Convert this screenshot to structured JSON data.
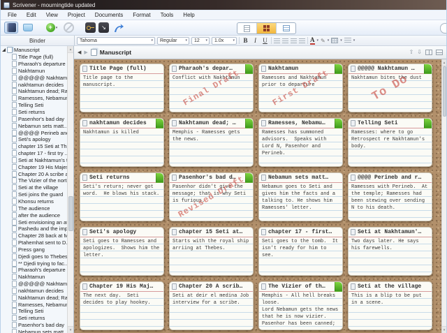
{
  "window": {
    "title": "Scrivener - mourningtide updated"
  },
  "menu": {
    "items": [
      "File",
      "Edit",
      "View",
      "Project",
      "Documents",
      "Format",
      "Tools",
      "Help"
    ]
  },
  "toolbar": {
    "buttons": [
      "binder",
      "collections",
      "add",
      "no-style",
      "keywords",
      "full-screen",
      "compose"
    ],
    "view_modes": [
      "document",
      "corkboard",
      "outliner"
    ],
    "active_view": "corkboard"
  },
  "format_bar": {
    "font": "Tahoma",
    "style": "Regular",
    "size": "12",
    "line_spacing": "1.0x",
    "bold": "B",
    "italic": "I",
    "underline": "U",
    "color_label": "A"
  },
  "icons": {
    "back": "◀",
    "forward": "▶",
    "nav_up": "⇧",
    "nav_down": "⇩",
    "caret": "▾",
    "plus": "+",
    "arrow_se": "↘",
    "scroll_up": "▴",
    "scroll_down": "▾",
    "pencil": "✎"
  },
  "binder": {
    "header": "Binder",
    "root": "Manuscript",
    "items": [
      "Title Page (full)",
      "Pharaoh's departure ...",
      "Nakhtamun",
      "@@@@@ Nakhtam...",
      "nakhtamun decides",
      "Nakhtamun dead; Ra...",
      "Ramesses, Nebamun...",
      "Telling Seti",
      "Seti returns",
      "Pasenhor's bad day",
      "Nebamun sets matt...",
      "@@@@ Perineb and ...",
      "Seti's apology",
      "chapter 15 Seti at Th...",
      "chapter 17 - first try ...",
      "Seti at Nakhtamun's t...",
      "Chapter 19 His Majes...",
      "Chapter 20 A scribe a...",
      "The Vizier of the north",
      "Seti at the village",
      "Seti joins the guard",
      "Khonsu returns",
      "The audience",
      "after the audience",
      "Seti envisioning an at...",
      "Pashedu and the imp...",
      "Chapter 28 back at M...",
      "Ptahemhat sent to D...",
      "Press gang",
      "Djedi goes to Thebes...",
      "** Djedi trying to fac...",
      "Pharaoh's departure ...",
      "Nakhtamun",
      "@@@@@ Nakhtam...",
      "nakhtamun decides",
      "Nakhtamun dead; Ra...",
      "Ramesses, Nebamun...",
      "Telling Seti",
      "Seti returns",
      "Pasenhor's bad day",
      "Nebamun sets matt..."
    ]
  },
  "editor_header": {
    "title": "Manuscript"
  },
  "corkboard": {
    "cards": [
      {
        "title": "Title Page (full)",
        "body": "Title page to the\nmanuscript.",
        "label": false,
        "stamp": null
      },
      {
        "title": "Pharaoh's depar…",
        "body": "Conflict with Nakhtamun",
        "label": true,
        "stamp": "Final Draft"
      },
      {
        "title": "Nakhtamun",
        "body": "Ramesses and Nakhtamun\nprior to departure",
        "label": true,
        "stamp": "First Draft"
      },
      {
        "title": "@@@@@ Nakhtamun …",
        "body": "Nakhtamun bites the dust",
        "label": true,
        "stamp": "To Do"
      },
      {
        "title": "nakhtamun decides",
        "body": "Nakhtamun is killed",
        "label": true,
        "stamp": null
      },
      {
        "title": "Nakhtamun dead; …",
        "body": "Memphis - Ramesses gets\nthe news.",
        "label": true,
        "stamp": null
      },
      {
        "title": "Ramesses, Nebamu…",
        "body": "Ramesses has summoned\nadvisors.  Speaks with\nLord N, Pasenhor and\nPerineb.",
        "label": true,
        "stamp": null
      },
      {
        "title": "Telling Seti",
        "body": "Ramesses: where to go\nRetrospect re Nakhtamun's\nbody.",
        "label": true,
        "stamp": null
      },
      {
        "title": "Seti returns",
        "body": "Seti's return; never got\nword.  He blows his stack.",
        "label": true,
        "stamp": null
      },
      {
        "title": "Pasenhor's bad d…",
        "body": "Pasenhor didn't give the\nmessage; that is why Seti\nis furious.",
        "label": true,
        "stamp": "Revised Draft"
      },
      {
        "title": "Nebamun sets matt…",
        "body": "Nebamun goes to Seti and\ngives him the facts and a\ntalking to. He shows him\nRamesses' letter.",
        "label": false,
        "stamp": null
      },
      {
        "title": "@@@@ Perineb and r…",
        "body": "Ramesses with Perineb.  At\nthe temple; Ramesses had\nbeen stewing over sending\nN to his death.",
        "label": false,
        "stamp": null
      },
      {
        "title": "Seti's apology",
        "body": "Seti goes to Ramesses and\napologizes.  Shows him the\nletter.",
        "label": false,
        "stamp": null
      },
      {
        "title": "chapter 15 Seti at…",
        "body": "Starts with the royal ship\narriing at Thebes.",
        "label": false,
        "stamp": null
      },
      {
        "title": "chapter 17 - first…",
        "body": "Seti goes to the tomb.  It\nisn't ready for him to\nsee.",
        "label": false,
        "stamp": null
      },
      {
        "title": "Seti at Nakhtamun'…",
        "body": "Two days later. He says\nhis farewells.",
        "label": false,
        "stamp": null
      },
      {
        "title": "Chapter 19 His Maj…",
        "body": "The next day.  Seti\ndecides to play hookey.",
        "label": false,
        "stamp": null
      },
      {
        "title": "Chapter 20 A scrib…",
        "body": "Seti at deir el medina Job\ninterview for a scribe.",
        "label": false,
        "stamp": null
      },
      {
        "title": "The Vizier of th…",
        "body": "Memphis - All hell breaks\nloose.\nLord Nebamun gets the news\nthat he is now vizier.\nPasenhor has been canned;",
        "label": true,
        "stamp": null
      },
      {
        "title": "Seti at the village",
        "body": "This is a blip to be put\nin a scene.",
        "label": false,
        "stamp": null
      }
    ]
  },
  "colors": {
    "label_green": "#3f9c1c",
    "label_green_light": "#7ed63f",
    "stamp_red": "#c23b33",
    "cork": "#b2906b",
    "active_view": "#f2b63c"
  }
}
